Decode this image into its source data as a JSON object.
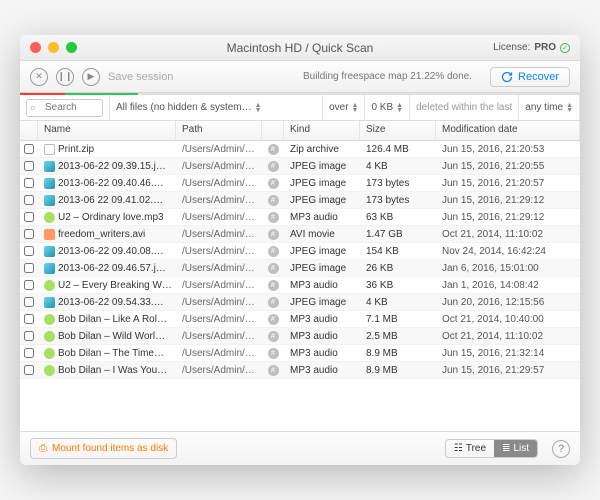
{
  "window": {
    "title": "Macintosh HD / Quick Scan"
  },
  "license": {
    "label": "License:",
    "tier": "PRO"
  },
  "toolbar": {
    "save_label": "Save session",
    "status": "Building freespace map 21.22% done.",
    "recover_label": "Recover"
  },
  "filters": {
    "search_placeholder": "Search",
    "file_filter": "All files (no hidden & system…",
    "size_op": "over",
    "size_val": "0 KB",
    "deleted_label": "deleted within the last",
    "time_val": "any time"
  },
  "columns": {
    "name": "Name",
    "path": "Path",
    "kind": "Kind",
    "size": "Size",
    "mod": "Modification date"
  },
  "rows": [
    {
      "icon": "zip",
      "name": "Print.zip",
      "path": "/Users/Admin/D…",
      "dot": "#",
      "kind": "Zip archive",
      "size": "126.4 MB",
      "mod": "Jun 15, 2016, 21:20:53"
    },
    {
      "icon": "img",
      "name": "2013-06-22 09.39.15.j…",
      "path": "/Users/Admin/P…",
      "dot": "#",
      "kind": "JPEG image",
      "size": "4 KB",
      "mod": "Jun 15, 2016, 21:20:55"
    },
    {
      "icon": "img",
      "name": "2013-06-22 09.40.46.…",
      "path": "/Users/Admin/P…",
      "dot": "#",
      "kind": "JPEG image",
      "size": "173 bytes",
      "mod": "Jun 15, 2016, 21:20:57"
    },
    {
      "icon": "img",
      "name": "2013-06 22 09.41.02.…",
      "path": "/Users/Admin/P…",
      "dot": "#",
      "kind": "JPEG image",
      "size": "173 bytes",
      "mod": "Jun 15, 2016, 21:29:12"
    },
    {
      "icon": "aud",
      "name": "U2 – Ordinary love.mp3",
      "path": "/Users/Admin/M…",
      "dot": "#",
      "kind": "MP3 audio",
      "size": "63 KB",
      "mod": "Jun 15, 2016, 21:29:12"
    },
    {
      "icon": "vid",
      "name": "freedom_writers.avi",
      "path": "/Users/Admin/…",
      "dot": "#",
      "kind": "AVI movie",
      "size": "1.47 GB",
      "mod": "Oct 21, 2014, 11:10:02"
    },
    {
      "icon": "img",
      "name": "2013-06-22 09.40.08.…",
      "path": "/Users/Admin/P…",
      "dot": "#",
      "kind": "JPEG image",
      "size": "154 KB",
      "mod": "Nov 24, 2014, 16:42:24"
    },
    {
      "icon": "img",
      "name": "2013-06-22 09.46.57.j…",
      "path": "/Users/Admin/P…",
      "dot": "#",
      "kind": "JPEG image",
      "size": "26 KB",
      "mod": "Jan 6, 2016, 15:01:00"
    },
    {
      "icon": "aud",
      "name": "U2 – Every Breaking W…",
      "path": "/Users/Admin/M…",
      "dot": "#",
      "kind": "MP3 audio",
      "size": "36 KB",
      "mod": "Jan 1, 2016, 14:08:42"
    },
    {
      "icon": "img",
      "name": "2013-06-22 09.54.33.…",
      "path": "/Users/Admin/P…",
      "dot": "#",
      "kind": "JPEG image",
      "size": "4 KB",
      "mod": "Jun 20, 2016, 12:15:56"
    },
    {
      "icon": "aud",
      "name": "Bob Dilan – Like A Rol…",
      "path": "/Users/Admin/M…",
      "dot": "#",
      "kind": "MP3 audio",
      "size": "7.1 MB",
      "mod": "Oct 21, 2014, 10:40:00"
    },
    {
      "icon": "aud",
      "name": "Bob Dilan – Wild Worl…",
      "path": "/Users/Admin/M…",
      "dot": "#",
      "kind": "MP3 audio",
      "size": "2.5 MB",
      "mod": "Oct 21, 2014, 11:10:02"
    },
    {
      "icon": "aud",
      "name": "Bob Dilan – The Time…",
      "path": "/Users/Admin/M…",
      "dot": "#",
      "kind": "MP3 audio",
      "size": "8.9 MB",
      "mod": "Jun 15, 2016, 21:32:14"
    },
    {
      "icon": "aud",
      "name": "Bob Dilan – I Was You…",
      "path": "/Users/Admin/M…",
      "dot": "#",
      "kind": "MP3 audio",
      "size": "8.9 MB",
      "mod": "Jun 15, 2016, 21:29:57"
    }
  ],
  "footer": {
    "mount_label": "Mount found items as disk",
    "tree_label": "Tree",
    "list_label": "List"
  }
}
